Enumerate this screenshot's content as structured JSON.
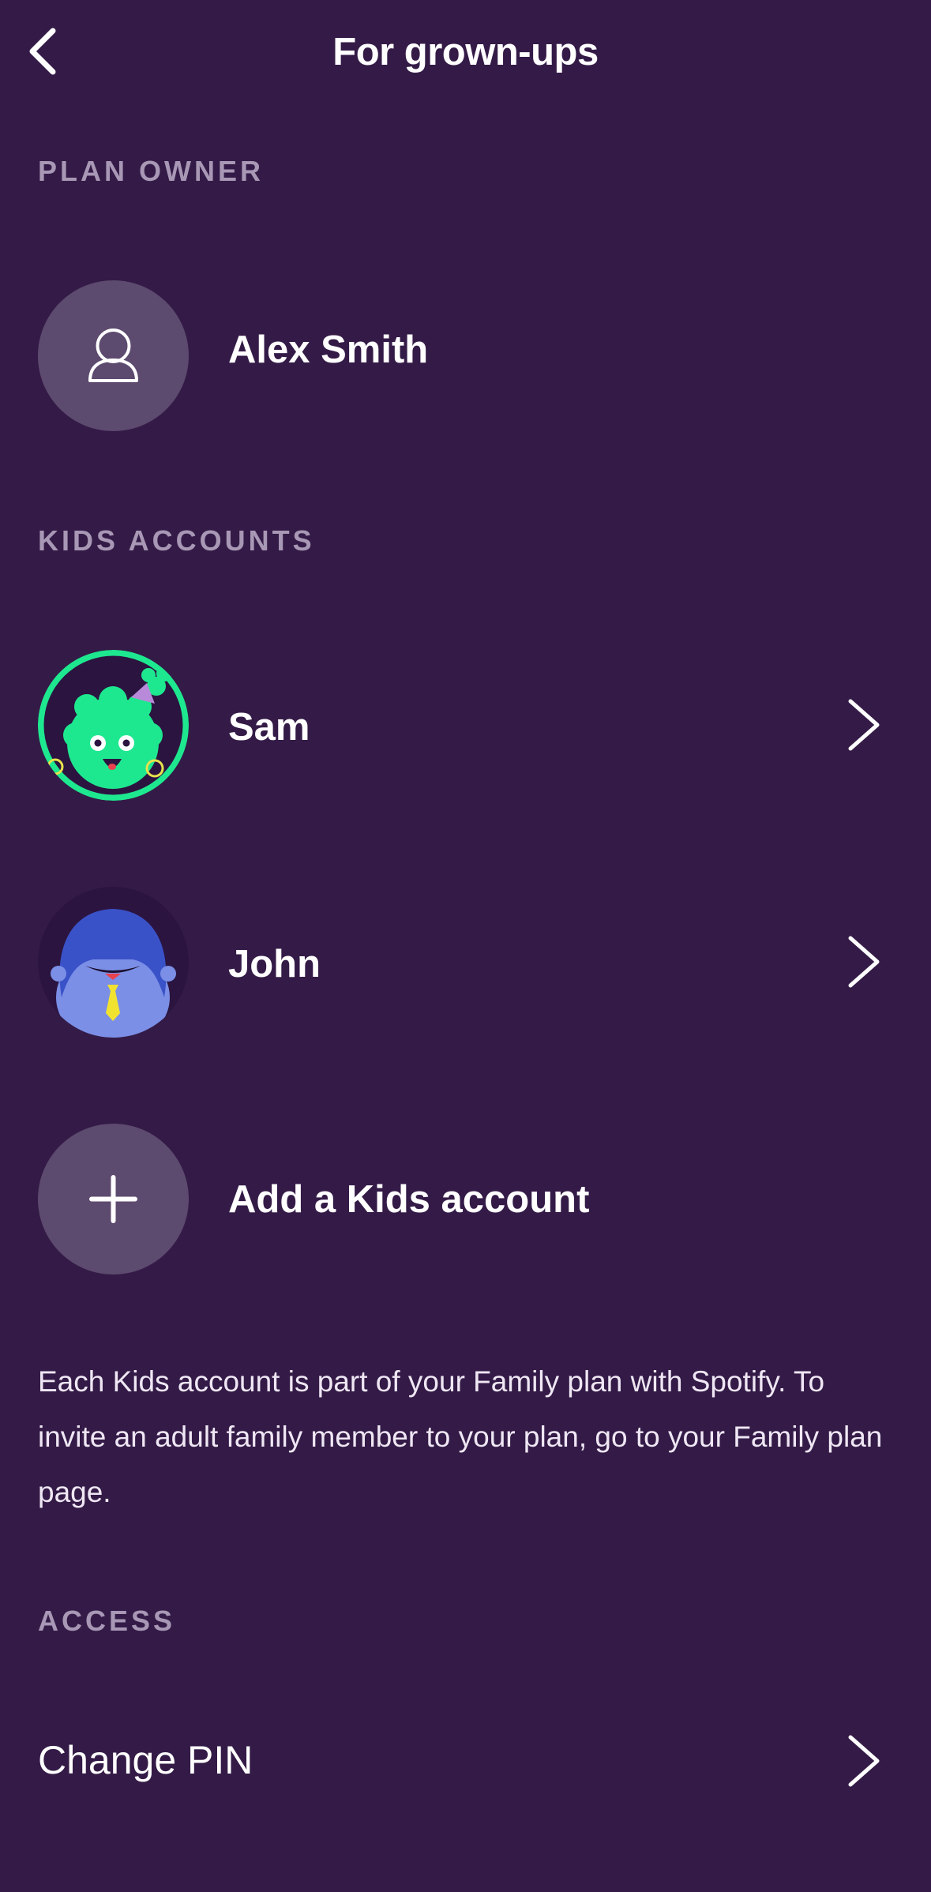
{
  "header": {
    "title": "For grown-ups",
    "back_icon": "chevron-left-icon"
  },
  "sections": {
    "plan_owner": "PLAN OWNER",
    "kids_accounts": "KIDS ACCOUNTS",
    "access": "ACCESS"
  },
  "plan_owner": {
    "name": "Alex Smith",
    "avatar_icon": "person-icon"
  },
  "kids": [
    {
      "name": "Sam",
      "avatar": "green-monster-avatar"
    },
    {
      "name": "John",
      "avatar": "blue-monster-avatar"
    }
  ],
  "add_kid": {
    "label": "Add a Kids account",
    "icon": "plus-icon"
  },
  "description": "Each Kids account is part of your Family plan with Spotify. To invite an adult family member to your plan, go to your Family plan page.",
  "access": {
    "change_pin_label": "Change PIN"
  },
  "colors": {
    "background": "#341b47",
    "section_label": "#a897b5",
    "avatar_grey": "#5d4a6f",
    "sam_green": "#1ee88f",
    "john_blue": "#7b8fe6"
  }
}
